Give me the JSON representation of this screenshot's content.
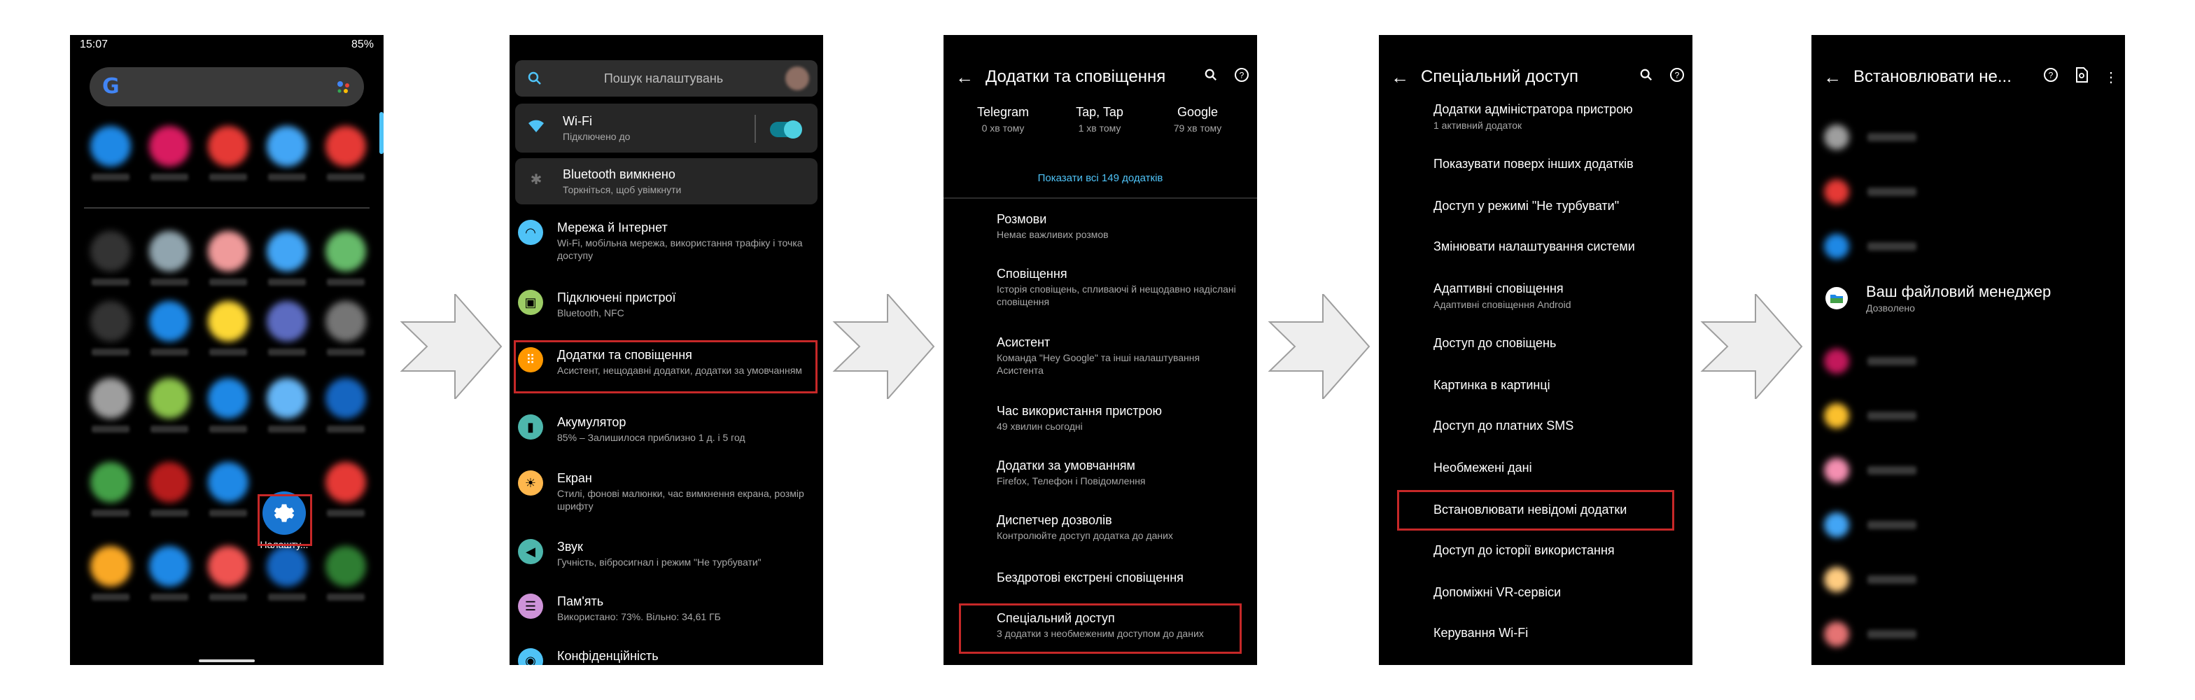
{
  "screen1": {
    "status_time": "15:07",
    "status_battery": "85%",
    "settings_app_label": "Налашту..."
  },
  "screen2": {
    "search_placeholder": "Пошук налаштувань",
    "items": [
      {
        "title": "Wi-Fi",
        "sub": "Підключено до",
        "color": "#4fc3f7"
      },
      {
        "title": "Bluetooth вимкнено",
        "sub": "Торкніться, щоб увімкнути",
        "color": "#757575"
      },
      {
        "title": "Мережа й Інтернет",
        "sub": "Wi-Fi, мобільна мережа, використання трафіку і точка доступу",
        "color": "#4fc3f7"
      },
      {
        "title": "Підключені пристрої",
        "sub": "Bluetooth, NFC",
        "color": "#9ccc65"
      },
      {
        "title": "Додатки та сповіщення",
        "sub": "Асистент, нещодавні додатки, додатки за умовчанням",
        "color": "#ff9800"
      },
      {
        "title": "Акумулятор",
        "sub": "85% – Залишилося приблизно 1 д. і 5 год",
        "color": "#4db6ac"
      },
      {
        "title": "Екран",
        "sub": "Стилі, фонові малюнки, час вимкнення екрана, розмір шрифту",
        "color": "#ffb74d"
      },
      {
        "title": "Звук",
        "sub": "Гучність, вібросигнал і режим \"Не турбувати\"",
        "color": "#4db6ac"
      },
      {
        "title": "Пам'ять",
        "sub": "Використано: 73%. Вільно: 34,61 ГБ",
        "color": "#ce93d8"
      },
      {
        "title": "Конфіденційність",
        "sub": "",
        "color": "#4fc3f7"
      }
    ]
  },
  "screen3": {
    "title": "Додатки та сповіщення",
    "recent": [
      {
        "name": "Telegram",
        "time": "0 хв тому"
      },
      {
        "name": "Tap, Tap",
        "time": "1 хв тому"
      },
      {
        "name": "Google",
        "time": "79 хв тому"
      }
    ],
    "show_all": "Показати всі 149 додатків",
    "items": [
      {
        "title": "Розмови",
        "sub": "Немає важливих розмов"
      },
      {
        "title": "Сповіщення",
        "sub": "Історія сповіщень, спливаючі й нещодавно надіслані сповіщення"
      },
      {
        "title": "Асистент",
        "sub": "Команда \"Hey Google\" та інші налаштування Асистента"
      },
      {
        "title": "Час використання пристрою",
        "sub": "49 хвилин сьогодні"
      },
      {
        "title": "Додатки за умовчанням",
        "sub": "Firefox, Телефон і Повідомлення"
      },
      {
        "title": "Диспетчер дозволів",
        "sub": "Контролюйте доступ додатка до даних"
      },
      {
        "title": "Бездротові екстрені сповіщення",
        "sub": ""
      },
      {
        "title": "Спеціальний доступ",
        "sub": "3 додатки з необмеженим доступом до даних"
      }
    ]
  },
  "screen4": {
    "title": "Спеціальний доступ",
    "items": [
      {
        "title": "Додатки адміністратора пристрою",
        "sub": "1 активний додаток"
      },
      {
        "title": "Показувати поверх інших додатків",
        "sub": ""
      },
      {
        "title": "Доступ у режимі \"Не турбувати\"",
        "sub": ""
      },
      {
        "title": "Змінювати налаштування системи",
        "sub": ""
      },
      {
        "title": "Адаптивні сповіщення",
        "sub": "Адаптивні сповіщення Android"
      },
      {
        "title": "Доступ до сповіщень",
        "sub": ""
      },
      {
        "title": "Картинка в картинці",
        "sub": ""
      },
      {
        "title": "Доступ до платних SMS",
        "sub": ""
      },
      {
        "title": "Необмежені дані",
        "sub": ""
      },
      {
        "title": "Встановлювати невідомі додатки",
        "sub": ""
      },
      {
        "title": "Доступ до історії використання",
        "sub": ""
      },
      {
        "title": "Допоміжні VR-сервіси",
        "sub": ""
      },
      {
        "title": "Керування Wi-Fi",
        "sub": ""
      }
    ]
  },
  "screen5": {
    "title": "Встановлювати не...",
    "file_manager_title": "Ваш файловий менеджер",
    "file_manager_sub": "Дозволено"
  },
  "colors": {
    "highlight": "#c62828",
    "accent": "#4fc3f7"
  }
}
